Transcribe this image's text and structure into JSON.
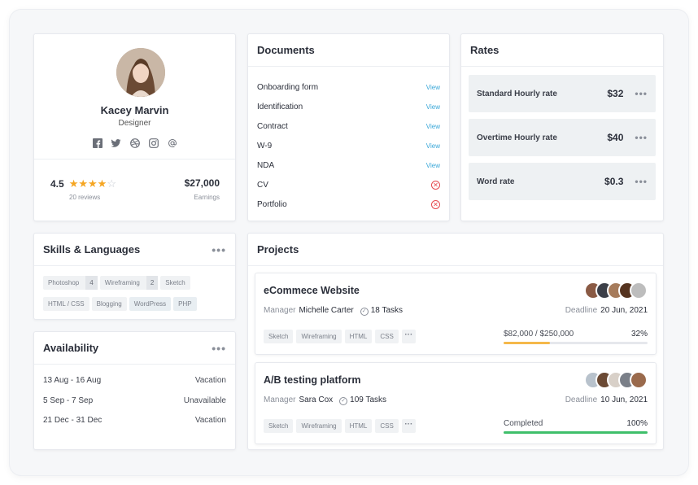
{
  "profile": {
    "name": "Kacey Marvin",
    "role": "Designer",
    "socials": [
      "facebook-icon",
      "twitter-icon",
      "dribbble-icon",
      "instagram-icon",
      "at-icon"
    ],
    "rating": "4.5",
    "rating_value": 4,
    "reviews": "20 reviews",
    "earnings": "$27,000",
    "earnings_label": "Earnings"
  },
  "documents": {
    "title": "Documents",
    "items": [
      {
        "name": "Onboarding form",
        "action": "View",
        "status": "view"
      },
      {
        "name": "Identification",
        "action": "View",
        "status": "view"
      },
      {
        "name": "Contract",
        "action": "View",
        "status": "view"
      },
      {
        "name": "W-9",
        "action": "View",
        "status": "view"
      },
      {
        "name": "NDA",
        "action": "View",
        "status": "view"
      },
      {
        "name": "CV",
        "action": "",
        "status": "missing"
      },
      {
        "name": "Portfolio",
        "action": "",
        "status": "missing"
      }
    ]
  },
  "rates": {
    "title": "Rates",
    "items": [
      {
        "label": "Standard Hourly rate",
        "value": "$32"
      },
      {
        "label": "Overtime Hourly rate",
        "value": "$40"
      },
      {
        "label": "Word rate",
        "value": "$0.3"
      }
    ]
  },
  "skills": {
    "title": "Skills & Languages",
    "tags": [
      {
        "label": "Photoshop",
        "count": "4"
      },
      {
        "label": "Wireframing",
        "count": "2"
      },
      {
        "label": "Sketch",
        "count": ""
      },
      {
        "label": "HTML / CSS",
        "count": ""
      },
      {
        "label": "Blogging",
        "count": ""
      },
      {
        "label": "WordPress",
        "count": "",
        "highlight": true
      },
      {
        "label": "PHP",
        "count": "",
        "highlight": true
      }
    ]
  },
  "availability": {
    "title": "Availability",
    "items": [
      {
        "dates": "13 Aug - 16 Aug",
        "type": "Vacation"
      },
      {
        "dates": "5 Sep - 7 Sep",
        "type": "Unavailable"
      },
      {
        "dates": "21 Dec - 31 Dec",
        "type": "Vacation"
      }
    ]
  },
  "projects": {
    "title": "Projects",
    "items": [
      {
        "name": "eCommece Website",
        "manager_label": "Manager",
        "manager": "Michelle Carter",
        "tasks": "18 Tasks",
        "deadline_label": "Deadline",
        "deadline": "20 Jun, 2021",
        "tags": [
          "Sketch",
          "Wireframing",
          "HTML",
          "CSS"
        ],
        "progress_text": "$82,000 / $250,000",
        "progress_pct": "32%",
        "progress": 0.32,
        "progress_color": "#f5b84a"
      },
      {
        "name": "A/B testing platform",
        "manager_label": "Manager",
        "manager": "Sara Cox",
        "tasks": "109 Tasks",
        "deadline_label": "Deadline",
        "deadline": "10 Jun, 2021",
        "tags": [
          "Sketch",
          "Wireframing",
          "HTML",
          "CSS"
        ],
        "progress_text": "Completed",
        "progress_pct": "100%",
        "progress": 1.0,
        "progress_color": "#3fbf6b"
      }
    ]
  },
  "colors": {
    "accent": "#39a7d8",
    "error": "#e5484d",
    "star": "#f5a623"
  }
}
